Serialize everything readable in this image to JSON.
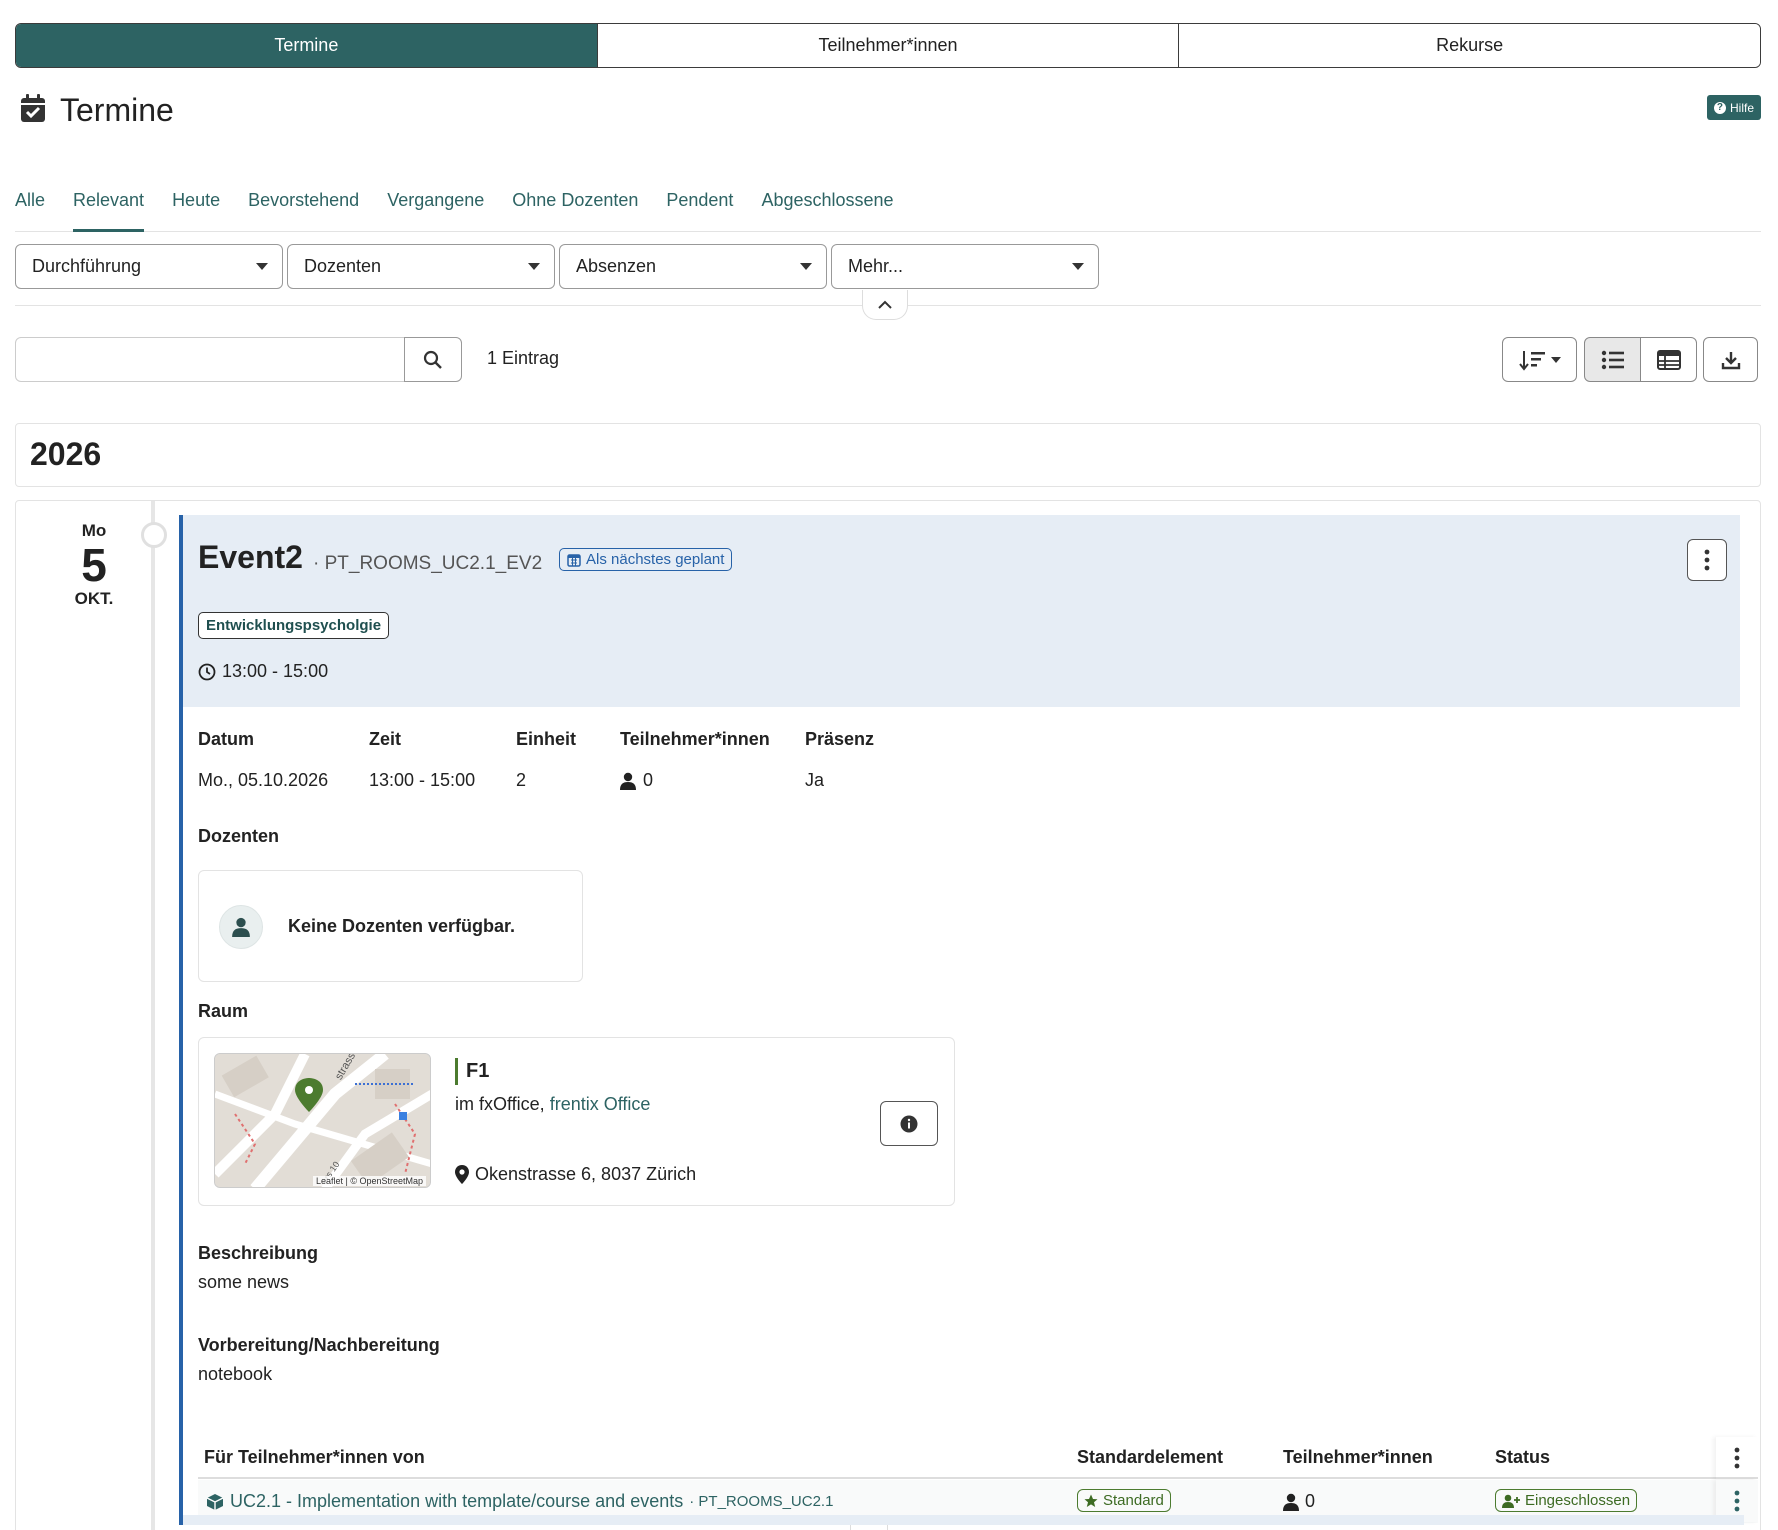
{
  "top_tabs": [
    {
      "label": "Termine",
      "active": true
    },
    {
      "label": "Teilnehmer*innen",
      "active": false
    },
    {
      "label": "Rekurse",
      "active": false
    }
  ],
  "page": {
    "title": "Termine",
    "help_label": "Hilfe"
  },
  "filter_tabs": [
    "Alle",
    "Relevant",
    "Heute",
    "Bevorstehend",
    "Vergangene",
    "Ohne Dozenten",
    "Pendent",
    "Abgeschlossene"
  ],
  "active_filter": "Relevant",
  "dropdowns": [
    "Durchführung",
    "Dozenten",
    "Absenzen",
    "Mehr..."
  ],
  "search": {
    "value": "",
    "placeholder": ""
  },
  "entry_count": "1 Eintrag",
  "year": "2026",
  "date": {
    "dow": "Mo",
    "day": "5",
    "month": "OKT."
  },
  "event": {
    "title": "Event2",
    "code": "· PT_ROOMS_UC2.1_EV2",
    "badge": "Als nächstes geplant",
    "subject": "Entwicklungspsycholgie",
    "time": "13:00 - 15:00",
    "details_labels": {
      "datum": "Datum",
      "zeit": "Zeit",
      "einheit": "Einheit",
      "teilnehmer": "Teilnehmer*innen",
      "praesenz": "Präsenz"
    },
    "details_values": {
      "datum": "Mo., 05.10.2026",
      "zeit": "13:00 - 15:00",
      "einheit": "2",
      "teilnehmer": "0",
      "praesenz": "Ja"
    },
    "dozenten_label": "Dozenten",
    "dozenten_empty": "Keine Dozenten verfügbar.",
    "raum_label": "Raum",
    "room": {
      "name": "F1",
      "location_prefix": "im fxOffice,",
      "location_link": "frentix Office",
      "address": "Okenstrasse 6, 8037 Zürich",
      "map_attribution": "Leaflet | © OpenStreetMap",
      "map_street_labels": [
        "strasse",
        "ers 10"
      ]
    },
    "beschreibung_label": "Beschreibung",
    "beschreibung": "some news",
    "vorbereitung_label": "Vorbereitung/Nachbereitung",
    "vorbereitung": "notebook"
  },
  "table": {
    "headers": [
      "Für Teilnehmer*innen von",
      "Standardelement",
      "Teilnehmer*innen",
      "Status"
    ],
    "rows": [
      {
        "course": "UC2.1 - Implementation with template/course and events",
        "code": "· PT_ROOMS_UC2.1",
        "standard": "Standard",
        "participants": "0",
        "status": "Eingeschlossen"
      }
    ]
  },
  "colors": {
    "primary": "#2d6363",
    "accent_blue": "#2762a8",
    "success": "#4c7b2f",
    "card_bg": "#e6edf5"
  }
}
